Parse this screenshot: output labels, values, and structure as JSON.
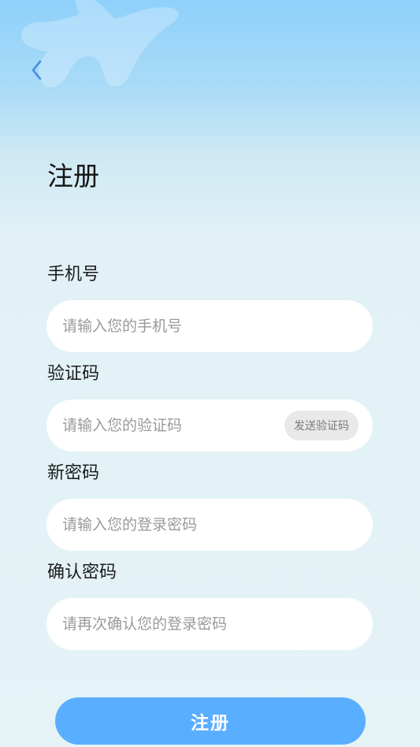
{
  "header": {
    "back_icon": "chevron-left-icon",
    "title": "注册"
  },
  "form": {
    "phone": {
      "label": "手机号",
      "placeholder": "请输入您的手机号",
      "value": ""
    },
    "code": {
      "label": "验证码",
      "placeholder": "请输入您的验证码",
      "value": "",
      "send_label": "发送验证码"
    },
    "password": {
      "label": "新密码",
      "placeholder": "请输入您的登录密码",
      "value": ""
    },
    "confirm": {
      "label": "确认密码",
      "placeholder": "请再次确认您的登录密码",
      "value": ""
    }
  },
  "submit_label": "注册",
  "colors": {
    "accent": "#5aaeff",
    "back_icon": "#4a90e2",
    "background_top": "#8fd0fb",
    "background_bottom": "#e5f3f7"
  }
}
